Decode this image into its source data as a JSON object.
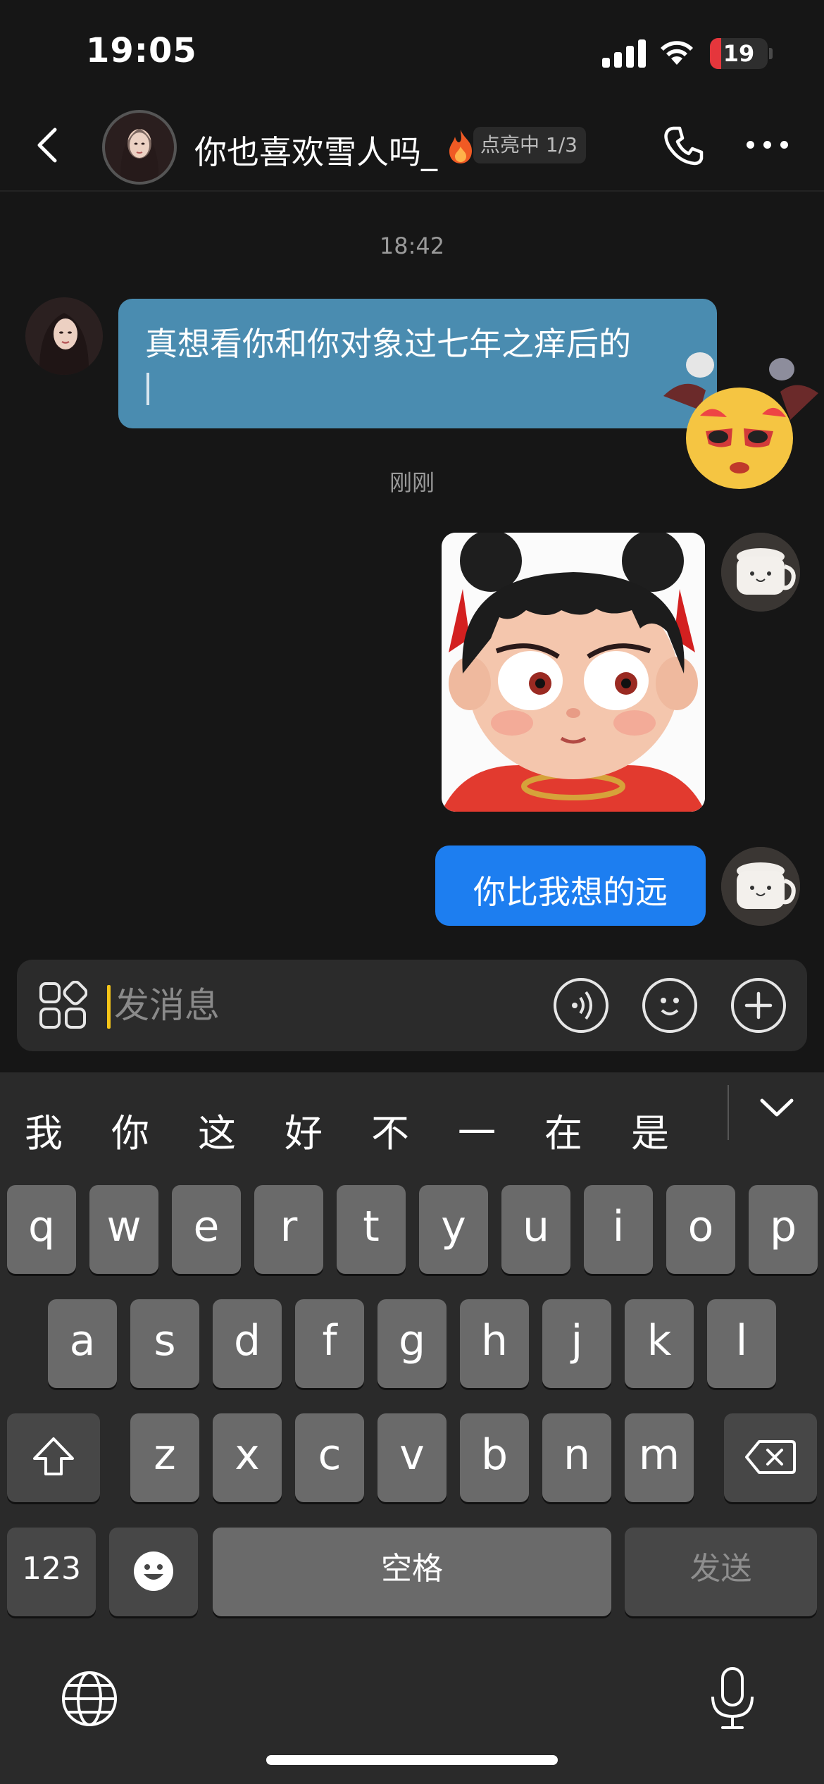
{
  "status_bar": {
    "time": "19:05",
    "battery_level": "19",
    "battery_color": "#e5363c"
  },
  "header": {
    "contact_name": "你也喜欢雪人吗_",
    "badge_text": "点亮中 1/3",
    "icons": {
      "back": "chevron-left-icon",
      "phone": "phone-icon",
      "more": "more-dots-icon",
      "fire": "fire-icon"
    }
  },
  "messages": [
    {
      "type": "timestamp",
      "text": "18:42"
    },
    {
      "type": "text",
      "direction": "incoming",
      "text": "真想看你和你对象过七年之痒后的"
    },
    {
      "type": "timestamp",
      "text": "刚刚"
    },
    {
      "type": "image",
      "direction": "outgoing",
      "description_icon": "cartoon-girl-sticker"
    },
    {
      "type": "text",
      "direction": "outgoing",
      "text": "你比我想的远"
    }
  ],
  "input": {
    "placeholder": "发消息",
    "icons": [
      "apps-grid-icon",
      "voice-icon",
      "emoji-icon",
      "plus-icon"
    ]
  },
  "keyboard": {
    "suggestions": [
      "我",
      "你",
      "这",
      "好",
      "不",
      "一",
      "在",
      "是"
    ],
    "row1": [
      "q",
      "w",
      "e",
      "r",
      "t",
      "y",
      "u",
      "i",
      "o",
      "p"
    ],
    "row2": [
      "a",
      "s",
      "d",
      "f",
      "g",
      "h",
      "j",
      "k",
      "l"
    ],
    "row3": [
      "z",
      "x",
      "c",
      "v",
      "b",
      "n",
      "m"
    ],
    "numbers_key": "123",
    "space_key": "空格",
    "send_key": "发送",
    "icons": [
      "shift-icon",
      "backspace-icon",
      "emoji-key-icon",
      "globe-icon",
      "microphone-icon",
      "chevron-down-icon"
    ]
  },
  "colors": {
    "incoming_bubble": "#4a8cb0",
    "outgoing_bubble": "#1d7ef0",
    "background": "#161616"
  }
}
